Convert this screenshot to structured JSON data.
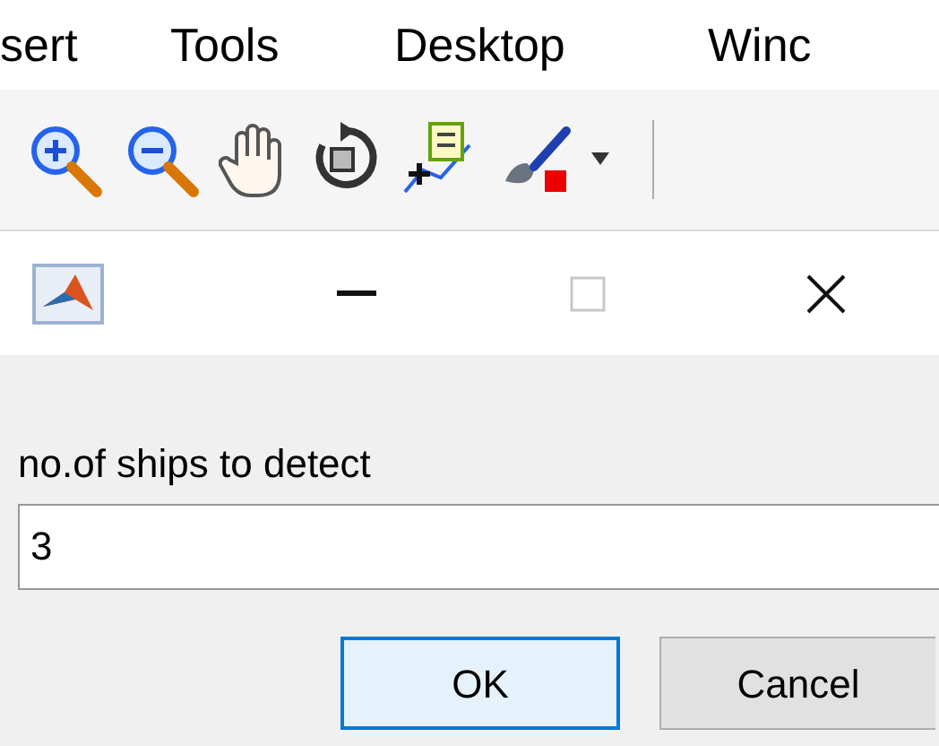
{
  "menu_bar": {
    "items": [
      "sert",
      "Tools",
      "Desktop",
      "Winc"
    ]
  },
  "dialog": {
    "prompt": "no.of ships to detect",
    "field": {
      "value": "3"
    },
    "buttons": [
      {
        "label": "OK",
        "selected": true
      },
      {
        "label": "Cancel",
        "selected": false
      }
    ]
  }
}
